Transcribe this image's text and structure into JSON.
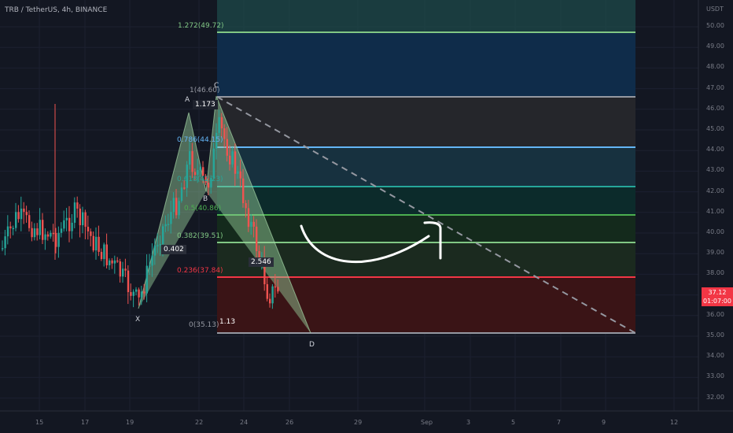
{
  "header": {
    "title": "TRB / TetherUS, 4h, BINANCE"
  },
  "price_axis": {
    "currency": "USDT",
    "ticks": [
      "50.00",
      "49.00",
      "48.00",
      "47.00",
      "46.00",
      "45.00",
      "44.00",
      "43.00",
      "42.00",
      "41.00",
      "40.00",
      "39.00",
      "38.00",
      "37.00",
      "36.00",
      "35.00",
      "34.00",
      "33.00",
      "32.00"
    ],
    "current_price": "37.12",
    "countdown": "01:07:00",
    "badge_color": "#f23645"
  },
  "time_axis": {
    "ticks": [
      "15",
      "17",
      "19",
      "22",
      "24",
      "26",
      "29",
      "Sep",
      "3",
      "5",
      "7",
      "9",
      "12"
    ]
  },
  "fib_levels": [
    {
      "label": "1.272(49.72)",
      "color": "#81c784"
    },
    {
      "label": "1(46.60)",
      "color": "#787b86"
    },
    {
      "label": "0.786(44.15)",
      "color": "#64b5f6"
    },
    {
      "label": "0.618(42.23)",
      "color": "#26a69a"
    },
    {
      "label": "0.5(40.86)",
      "color": "#4caf50"
    },
    {
      "label": "0.382(39.51)",
      "color": "#81c784"
    },
    {
      "label": "0.236(37.84)",
      "color": "#f23645"
    },
    {
      "label": "0(35.13)",
      "color": "#787b86"
    }
  ],
  "pattern": {
    "points": [
      "X",
      "A",
      "B",
      "C",
      "D"
    ],
    "ratios": [
      "1.173",
      "0.402",
      "2.546",
      "1.13"
    ]
  },
  "colors": {
    "up": "#26a69a",
    "down": "#ef5350",
    "background": "#131722"
  }
}
